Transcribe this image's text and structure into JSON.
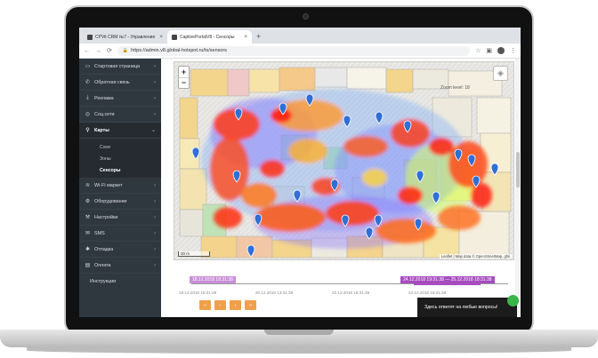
{
  "browser": {
    "tabs": [
      {
        "label": "CPVit CRM №7 - Управление",
        "active": false
      },
      {
        "label": "CaptivePortalV8 - Сенсоры",
        "active": true
      }
    ],
    "url": "https://admin.v8.global-hotspot.ru/ts/sensors"
  },
  "sidebar": {
    "items": [
      {
        "label": "Стартовая страница",
        "icon": "monitor-icon"
      },
      {
        "label": "Обратная связь",
        "icon": "feedback-icon"
      },
      {
        "label": "Реклама",
        "icon": "ad-icon"
      },
      {
        "label": "Соц.сети",
        "icon": "social-icon"
      },
      {
        "label": "Карты",
        "icon": "pin-icon",
        "open": true
      },
      {
        "label": "Wi-Fi маркет",
        "icon": "wifi-icon"
      },
      {
        "label": "Оборудование",
        "icon": "equipment-icon"
      },
      {
        "label": "Настройки",
        "icon": "settings-icon"
      },
      {
        "label": "SMS",
        "icon": "sms-icon"
      },
      {
        "label": "Отладка",
        "icon": "debug-icon"
      },
      {
        "label": "Оплата",
        "icon": "payment-icon"
      }
    ],
    "sub_items": [
      "Схеи",
      "Зоны",
      "Сенсоры"
    ],
    "selected_sub": "Сенсоры",
    "extra": "Инструкции"
  },
  "map": {
    "zoom_in": "+",
    "zoom_out": "−",
    "zoom_level": "Zoom level: 18",
    "scale": "30 m",
    "attribution": "Leaflet | Map data © OpenStreetMap, gfsi"
  },
  "timeline": {
    "range_start": "18.12.2018 18:31:38",
    "range_selected": "24.12.2018 19:31:38 — 25.12.2018 18:31:38",
    "ticks": [
      "18.12.2018 18:31:38",
      "20.12.2018 13:31:38",
      "22.12.2018 18:31:38",
      "24.12.2018 18:31:38"
    ],
    "controls": [
      "‹‹",
      "‹",
      "›",
      "››"
    ]
  },
  "chat": {
    "text": "Здесь ответят на любые вопросы!"
  }
}
